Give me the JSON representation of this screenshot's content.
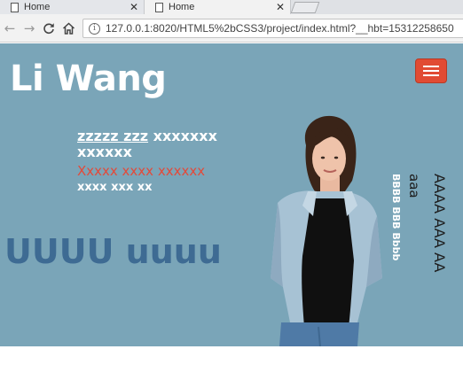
{
  "browser": {
    "tabs": [
      {
        "title": "Home",
        "active": false
      },
      {
        "title": "Home",
        "active": true
      }
    ],
    "url": "127.0.0.1:8020/HTML5%2bCSS3/project/index.html?__hbt=15312258650"
  },
  "header": {
    "brand": "Li Wang"
  },
  "intro": {
    "line1_underlined": "zzzzz zzz",
    "line1_rest": " xxxxxxx xxxxxx",
    "line2": "Xxxxx xxxx xxxxxx",
    "line3": "xxxx xxx xx"
  },
  "headline": "UUUU uuuu",
  "side_text": {
    "v1": "AAAA AAA AA",
    "v2": "aaa",
    "v3": "BBBB BBB Bbbb"
  },
  "colors": {
    "page_bg": "#7aa5b8",
    "menu_button": "#e14b33",
    "accent_text": "#e34a3a",
    "headline": "#3e6b93"
  }
}
